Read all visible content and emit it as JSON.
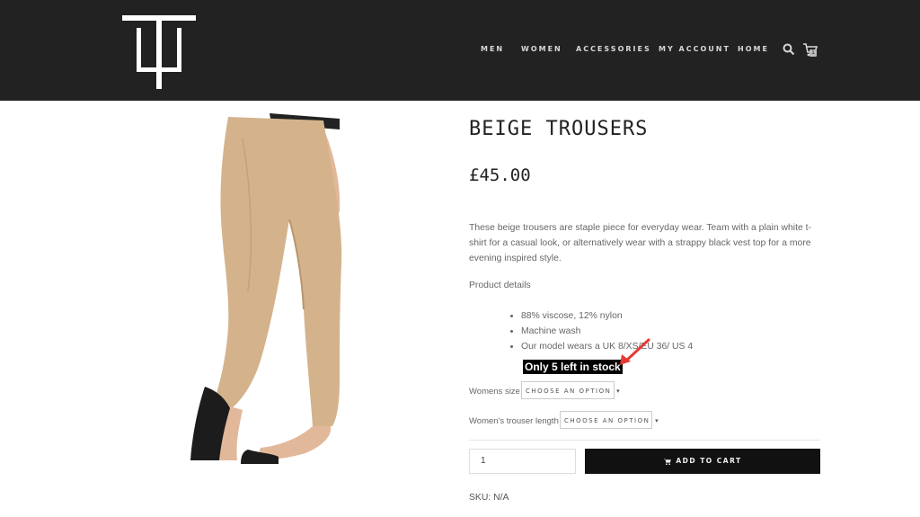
{
  "nav": {
    "items": [
      {
        "label": "MEN"
      },
      {
        "label": "WOMEN"
      },
      {
        "label": "ACCESSORIES"
      },
      {
        "label": "MY ACCOUNT"
      },
      {
        "label": "HOME"
      }
    ],
    "cart_count": "1"
  },
  "icons": {
    "logo": "tw-monogram-logo",
    "search": "search-icon",
    "cart": "cart-icon",
    "arrow": "red-annotation-arrow"
  },
  "colors": {
    "header_bg": "#222222",
    "button_bg": "#111111",
    "annotation_red": "#e53935"
  },
  "product": {
    "title": "BEIGE TROUSERS",
    "price": "£45.00",
    "description": "These beige trousers are staple piece for everyday wear. Team with a plain white t-shirt for a casual look, or alternatively wear with a strappy black vest top for a more evening inspired style.",
    "details_title": "Product details",
    "details": [
      "88% viscose, 12% nylon",
      "Machine wash",
      "Our model wears a UK 8/XS/EU 36/ US 4"
    ],
    "stock_note": "Only 5 left in stock",
    "options": [
      {
        "label": "Womens size",
        "value": "CHOOSE AN OPTION"
      },
      {
        "label": "Women's trouser length",
        "value": "CHOOSE AN OPTION"
      }
    ],
    "quantity": "1",
    "add_to_cart": "ADD TO CART",
    "sku": "SKU: N/A"
  }
}
